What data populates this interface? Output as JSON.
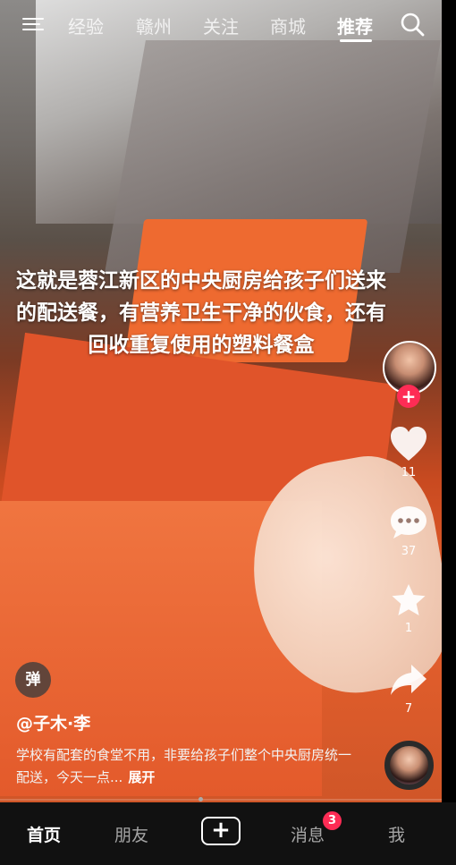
{
  "top_tabs": [
    {
      "label": "经验"
    },
    {
      "label": "赣州"
    },
    {
      "label": "关注"
    },
    {
      "label": "商城"
    },
    {
      "label": "推荐",
      "active": true
    }
  ],
  "caption": "这就是蓉江新区的中央厨房给孩子们送来的配送餐，有营养卫生干净的伙食，还有回收重复使用的塑料餐盒",
  "actions": {
    "like_count": "11",
    "comment_count": "37",
    "favorite_count": "1",
    "share_count": "7"
  },
  "follow_symbol": "+",
  "danmu_label": "弹",
  "author": "@子木·李",
  "description": "学校有配套的食堂不用，非要给孩子们整个中央厨房统一配送，今天一点...",
  "more_label": "展开",
  "bottom_nav": {
    "home": "首页",
    "friends": "朋友",
    "create": "+",
    "messages": "消息",
    "messages_badge": "3",
    "me": "我"
  },
  "colors": {
    "accent": "#fe2c55",
    "nav_bg": "#111111"
  }
}
